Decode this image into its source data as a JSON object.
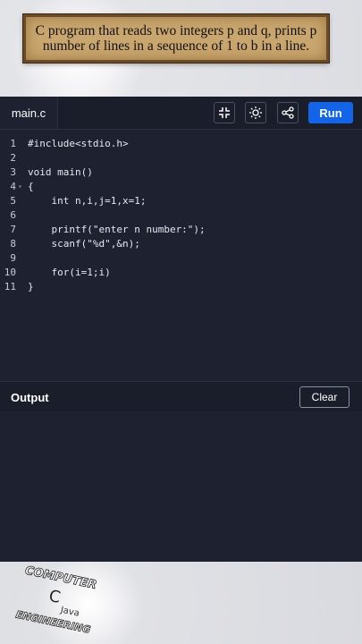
{
  "banner": {
    "title_line1": "C program that reads two integers p and q, prints p",
    "title_line2": "number of lines in a sequence of 1 to b in a line."
  },
  "editor": {
    "file_tab": "main.c",
    "toolbar_icons": [
      "fullscreen-exit-icon",
      "sun-icon",
      "share-icon"
    ],
    "run_label": "Run",
    "lines": [
      {
        "n": "1",
        "text": "#include<stdio.h>"
      },
      {
        "n": "2",
        "text": ""
      },
      {
        "n": "3",
        "text": "void main()"
      },
      {
        "n": "4",
        "text": "{"
      },
      {
        "n": "5",
        "text": "    int n,i,j=1,x=1;"
      },
      {
        "n": "6",
        "text": ""
      },
      {
        "n": "7",
        "text": "    printf(\"enter n number:\");"
      },
      {
        "n": "8",
        "text": "    scanf(\"%d\",&n);"
      },
      {
        "n": "9",
        "text": ""
      },
      {
        "n": "10",
        "text": "    for(i=1;i)"
      },
      {
        "n": "11",
        "text": "}"
      }
    ]
  },
  "output": {
    "title": "Output",
    "clear_label": "Clear"
  },
  "logo": {
    "text_top": "COMPUTER",
    "text_mid": "C",
    "text_java": "Java",
    "text_bottom": "ENGINEERING"
  },
  "colors": {
    "editor_bg": "#1e2130",
    "toolbar_bg": "#1a1d2a",
    "run_button": "#1264e8",
    "string_literal": "#e8b978"
  }
}
